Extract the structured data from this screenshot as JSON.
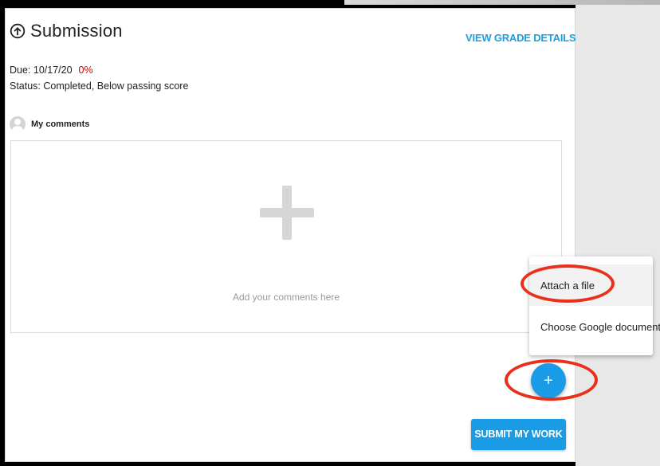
{
  "colors": {
    "accent": "#1a9be6",
    "link": "#1a9fe0",
    "score_red": "#d40000",
    "annotation_red": "#e8301b"
  },
  "header": {
    "icon": "upload-cloud-icon",
    "title": "Submission",
    "grade_link": "VIEW GRADE DETAILS"
  },
  "info": {
    "due_label": "Due: 10/17/20",
    "score": "0%",
    "status": "Status: Completed, Below passing score"
  },
  "comments": {
    "avatar_icon": "user-avatar-icon",
    "label": "My comments",
    "add_icon": "plus-icon",
    "placeholder": "Add your comments here"
  },
  "attach_menu": {
    "items": [
      {
        "label": "Attach a file",
        "highlighted": true
      },
      {
        "label": "Choose Google document",
        "highlighted": false
      }
    ]
  },
  "fab": {
    "symbol": "+",
    "icon": "add-icon"
  },
  "submit": {
    "label": "SUBMIT MY WORK"
  }
}
